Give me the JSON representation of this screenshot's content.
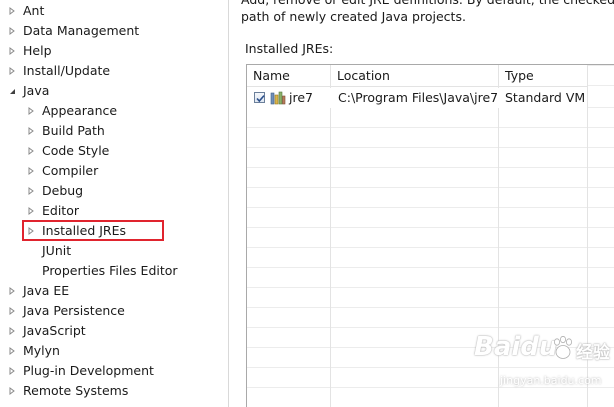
{
  "tree": {
    "items": [
      {
        "label": "Ant",
        "expandable": true,
        "expanded": false,
        "level": 0
      },
      {
        "label": "Data Management",
        "expandable": true,
        "expanded": false,
        "level": 0
      },
      {
        "label": "Help",
        "expandable": true,
        "expanded": false,
        "level": 0
      },
      {
        "label": "Install/Update",
        "expandable": true,
        "expanded": false,
        "level": 0
      },
      {
        "label": "Java",
        "expandable": true,
        "expanded": true,
        "level": 0
      },
      {
        "label": "Appearance",
        "expandable": true,
        "expanded": false,
        "level": 1
      },
      {
        "label": "Build Path",
        "expandable": true,
        "expanded": false,
        "level": 1
      },
      {
        "label": "Code Style",
        "expandable": true,
        "expanded": false,
        "level": 1
      },
      {
        "label": "Compiler",
        "expandable": true,
        "expanded": false,
        "level": 1
      },
      {
        "label": "Debug",
        "expandable": true,
        "expanded": false,
        "level": 1
      },
      {
        "label": "Editor",
        "expandable": true,
        "expanded": false,
        "level": 1
      },
      {
        "label": "Installed JREs",
        "expandable": true,
        "expanded": false,
        "level": 1,
        "highlighted": true
      },
      {
        "label": "JUnit",
        "expandable": false,
        "expanded": false,
        "level": 1
      },
      {
        "label": "Properties Files Editor",
        "expandable": false,
        "expanded": false,
        "level": 1
      },
      {
        "label": "Java EE",
        "expandable": true,
        "expanded": false,
        "level": 0
      },
      {
        "label": "Java Persistence",
        "expandable": true,
        "expanded": false,
        "level": 0
      },
      {
        "label": "JavaScript",
        "expandable": true,
        "expanded": false,
        "level": 0
      },
      {
        "label": "Mylyn",
        "expandable": true,
        "expanded": false,
        "level": 0
      },
      {
        "label": "Plug-in Development",
        "expandable": true,
        "expanded": false,
        "level": 0
      },
      {
        "label": "Remote Systems",
        "expandable": true,
        "expanded": false,
        "level": 0
      }
    ],
    "highlight_color": "#e0242e"
  },
  "content": {
    "description_line1": "Add, remove or edit JRE definitions. By default, the checked JRE",
    "description_line2": "path of newly created Java projects.",
    "section_label": "Installed JREs:",
    "table": {
      "columns": [
        "Name",
        "Location",
        "Type"
      ],
      "rows": [
        {
          "checked": true,
          "name": "jre7",
          "location": "C:\\Program Files\\Java\\jre7",
          "type": "Standard VM",
          "icon": "jre-library-icon"
        }
      ]
    }
  },
  "watermark": {
    "brand": "Baidu",
    "sub": "经验",
    "url": "jingyan.baidu.com"
  },
  "colors": {
    "border": "#a9a9a9",
    "gridline": "#ececec",
    "arrow": "#8a8a8a"
  }
}
